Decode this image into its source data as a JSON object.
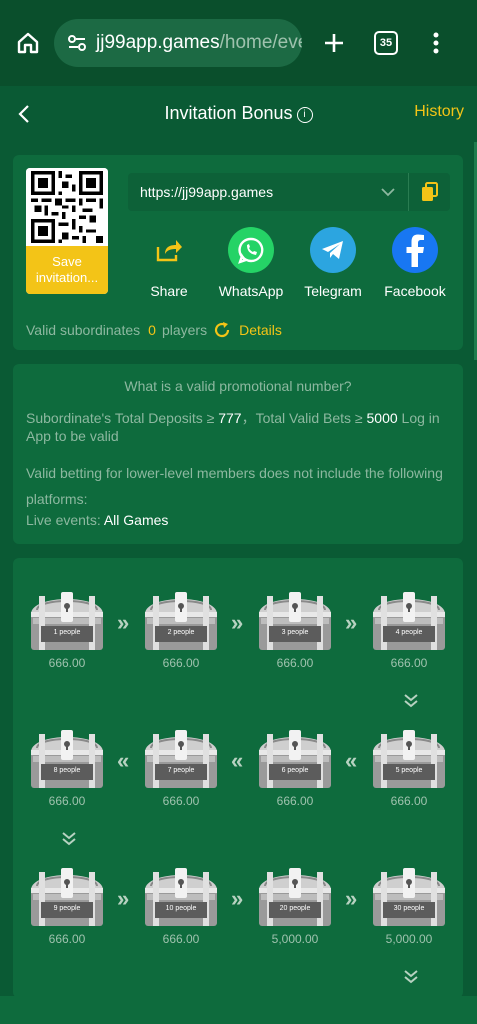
{
  "browser": {
    "url_host": "jj99app.games",
    "url_path": "/home/eve",
    "tab_count": "35"
  },
  "header": {
    "title": "Invitation Bonus",
    "info_symbol": "i",
    "history": "History"
  },
  "invite": {
    "save_label": "Save invitation...",
    "link": "https://jj99app.games",
    "share": [
      {
        "label": "Share",
        "icon": "share-icon"
      },
      {
        "label": "WhatsApp",
        "icon": "whatsapp-icon"
      },
      {
        "label": "Telegram",
        "icon": "telegram-icon"
      },
      {
        "label": "Facebook",
        "icon": "facebook-icon"
      }
    ],
    "subs_label": "Valid subordinates",
    "subs_count": "0",
    "subs_unit": "players",
    "details": "Details"
  },
  "rules": {
    "question": "What is a valid promotional number?",
    "r1_a": "Subordinate's Total Deposits ≥ ",
    "r1_b": "777",
    "r1_c": "，Total Valid Bets ≥ ",
    "r1_d": "5000",
    "r1_e": " Log in App to be valid",
    "r2": "Valid betting for lower-level members does not include the following platforms:",
    "r3_label": "Live events: ",
    "r3_value": "All Games"
  },
  "chests": [
    {
      "people": "1 people",
      "amount": "666.00"
    },
    {
      "people": "2 people",
      "amount": "666.00"
    },
    {
      "people": "3 people",
      "amount": "666.00"
    },
    {
      "people": "4 people",
      "amount": "666.00"
    },
    {
      "people": "5 people",
      "amount": "666.00"
    },
    {
      "people": "6 people",
      "amount": "666.00"
    },
    {
      "people": "7 people",
      "amount": "666.00"
    },
    {
      "people": "8 people",
      "amount": "666.00"
    },
    {
      "people": "9 people",
      "amount": "666.00"
    },
    {
      "people": "10 people",
      "amount": "666.00"
    },
    {
      "people": "20 people",
      "amount": "5,000.00"
    },
    {
      "people": "30 people",
      "amount": "5,000.00"
    }
  ],
  "colors": {
    "accent": "#f3c417",
    "background": "#0a5a34",
    "card": "#0e6b3d"
  }
}
